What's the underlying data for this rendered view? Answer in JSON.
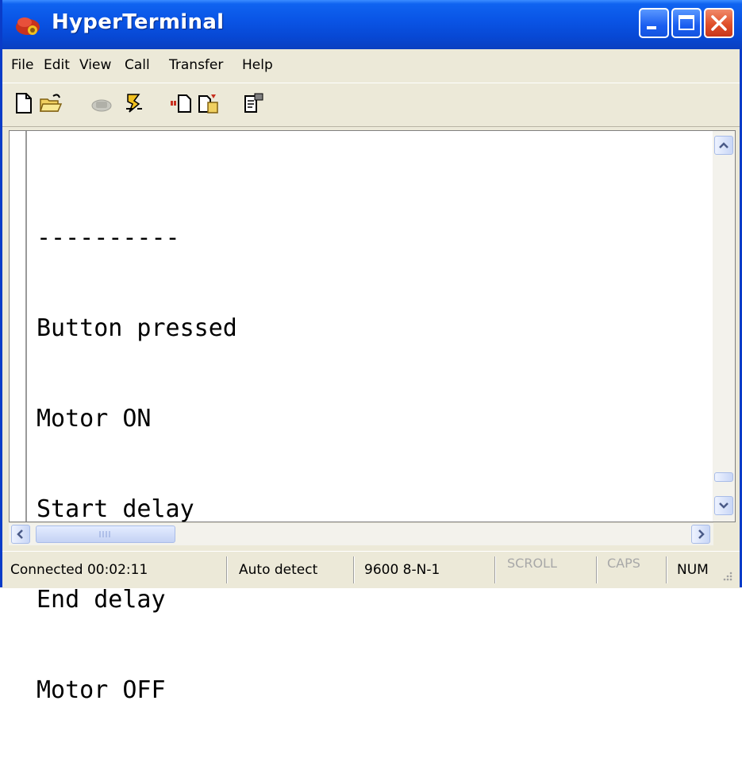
{
  "window": {
    "title": "HyperTerminal",
    "app_icon": "hyperterminal-phone-icon",
    "accent_color": "#0a55e6",
    "close_color": "#e0502a"
  },
  "menu": {
    "items": [
      "File",
      "Edit",
      "View",
      "Call",
      "Transfer",
      "Help"
    ]
  },
  "toolbar": {
    "icons": [
      "new-document-icon",
      "open-folder-icon",
      "connect-phone-icon",
      "disconnect-icon",
      "send-file-icon",
      "receive-file-icon",
      "properties-icon"
    ]
  },
  "terminal": {
    "lines": [
      "----------",
      "Button pressed",
      "Motor ON",
      "Start delay",
      "End delay",
      "Motor OFF"
    ]
  },
  "status": {
    "connected": "Connected 00:02:11",
    "detect": "Auto detect",
    "settings": "9600 8-N-1",
    "scroll": "SCROLL",
    "caps": "CAPS",
    "num": "NUM"
  }
}
